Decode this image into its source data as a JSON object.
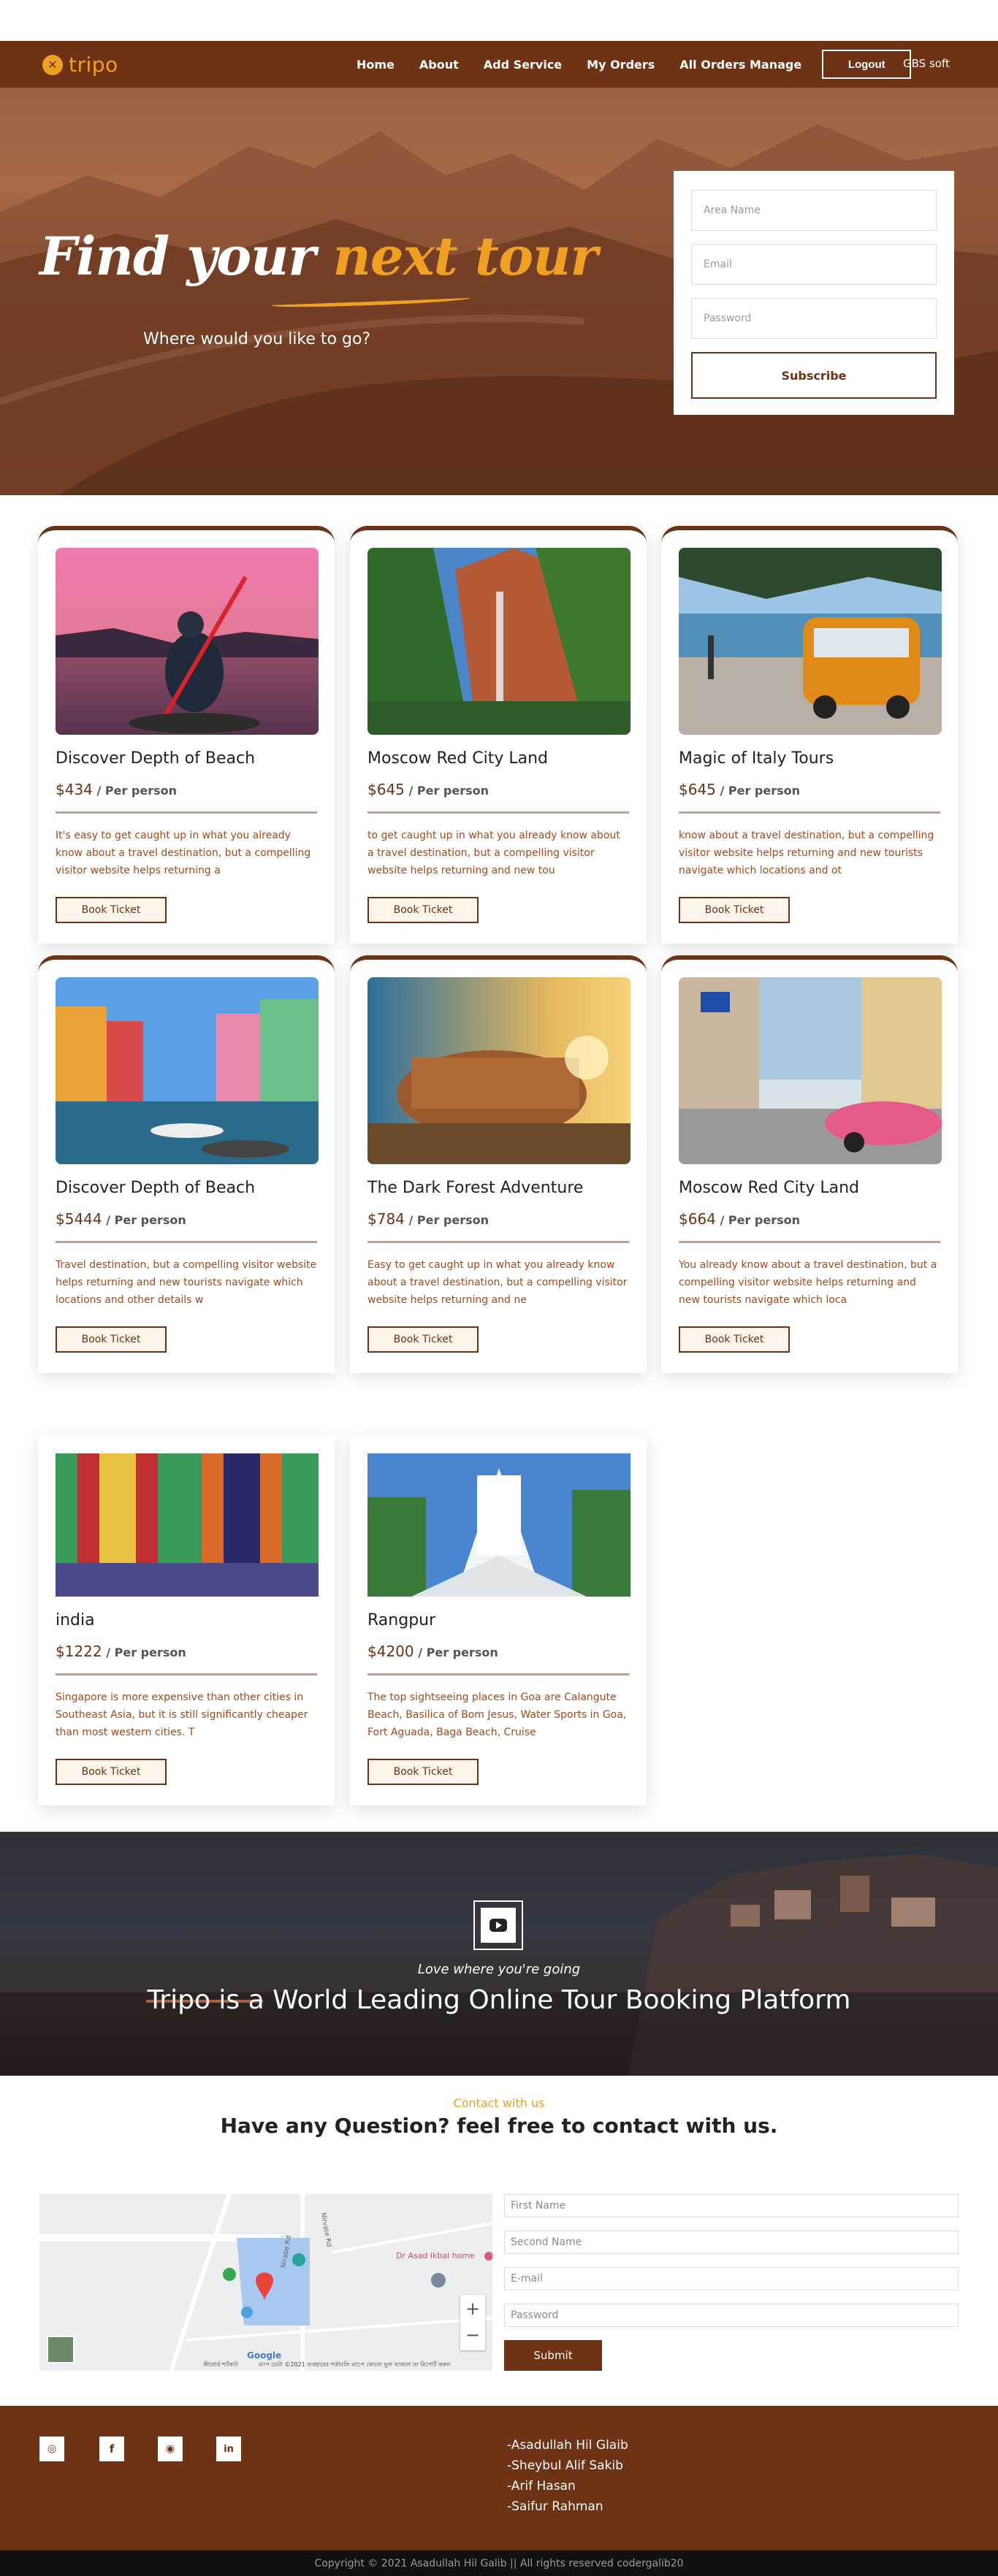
{
  "brand": {
    "name": "tripo",
    "badge_glyph": "✕",
    "color": "#f0a020"
  },
  "nav": {
    "links": [
      "Home",
      "About",
      "Add Service",
      "My Orders",
      "All Orders Manage"
    ],
    "logout_label": "Logout",
    "user": "GBS soft"
  },
  "hero": {
    "title_white": "Find your ",
    "title_highlight": "next tour",
    "subtitle": "Where would you like to go?",
    "form": {
      "area_placeholder": "Area Name",
      "email_placeholder": "Email",
      "password_placeholder": "Password",
      "subscribe_label": "Subscribe"
    }
  },
  "tours": [
    {
      "title": "Discover Depth of Beach",
      "price": "$434",
      "per": " / Per person",
      "desc": "It's easy to get caught up in what you already know about a travel destination, but a compelling visitor website helps returning a",
      "button": "Book Ticket",
      "image": "kayak-sunset"
    },
    {
      "title": "Moscow Red City Land",
      "price": "$645",
      "per": " / Per person",
      "desc": "to get caught up in what you already know about a travel destination, but a compelling visitor website helps returning and new tou",
      "button": "Book Ticket",
      "image": "canyon-waterfall"
    },
    {
      "title": "Magic of Italy Tours",
      "price": "$645",
      "per": " / Per person",
      "desc": "know about a travel destination, but a compelling visitor website helps returning and new tourists navigate which locations and ot",
      "button": "Book Ticket",
      "image": "orange-van-beach"
    },
    {
      "title": "Discover Depth of Beach",
      "price": "$5444",
      "per": " / Per person",
      "desc": "Travel destination, but a compelling visitor website helps returning and new tourists navigate which locations and other details w",
      "button": "Book Ticket",
      "image": "canal-houses"
    },
    {
      "title": "The Dark Forest Adventure",
      "price": "$784",
      "per": " / Per person",
      "desc": "Easy to get caught up in what you already know about a travel destination, but a compelling visitor website helps returning and ne",
      "button": "Book Ticket",
      "image": "colosseum"
    },
    {
      "title": "Moscow Red City Land",
      "price": "$664",
      "per": " / Per person",
      "desc": "You already know about a travel destination, but a compelling visitor website helps returning and new tourists navigate which loca",
      "button": "Book Ticket",
      "image": "pink-classic-car"
    },
    {
      "title": "india",
      "price": "$1222",
      "per": " / Per person",
      "desc": "Singapore is more expensive than other cities in Southeast Asia, but it is still significantly cheaper than most western cities. T",
      "button": "Book Ticket",
      "image": "people-scarves"
    },
    {
      "title": "Rangpur",
      "price": "$4200",
      "per": " / Per person",
      "desc": "The top sightseeing places in Goa are Calangute Beach, Basilica of Bom Jesus, Water Sports in Goa, Fort Aguada, Baga Beach, Cruise",
      "button": "Book Ticket",
      "image": "white-church"
    }
  ],
  "banner": {
    "tagline": "Love where you're going",
    "title": "Tripo is a World Leading Online Tour Booking Platform",
    "icon": "youtube-play-icon"
  },
  "contact": {
    "kicker": "Contact with us",
    "title": "Have any Question? feel free to contact with us.",
    "map": {
      "place_label": "Dr Asad ikbal home",
      "road_label_1": "Nirabe Rd",
      "road_label_2": "Nirvate Rd",
      "attribution": "Google",
      "copyright": "ম্যাপ ডেটা ©2021  ব্যবহারের শর্তাবলি  ম্যাপে কোনো ভুল থাকলে তা রিপোর্ট করুন",
      "shortcuts": "কীবোর্ড শর্টকাট",
      "zoom_in": "+",
      "zoom_out": "−"
    },
    "form": {
      "first_name_placeholder": "First Name",
      "second_name_placeholder": "Second Name",
      "email_placeholder": "E-mail",
      "password_placeholder": "Password",
      "submit_label": "Submit"
    }
  },
  "footer": {
    "social_icons": [
      "instagram-icon",
      "facebook-icon",
      "github-icon",
      "linkedin-icon"
    ],
    "social_glyphs": [
      "◎",
      "f",
      "◉",
      "in"
    ],
    "team": [
      "-Asadullah Hil Glaib",
      "-Sheybul Alif Sakib",
      "-Arif Hasan",
      "-Saifur Rahman"
    ],
    "copyright": "Copyright © 2021 Asadullah Hil Galib || All rights reserved codergalib20"
  },
  "colors": {
    "primary": "#6e3214",
    "accent": "#f0a020",
    "desc_text": "#a8491a"
  }
}
